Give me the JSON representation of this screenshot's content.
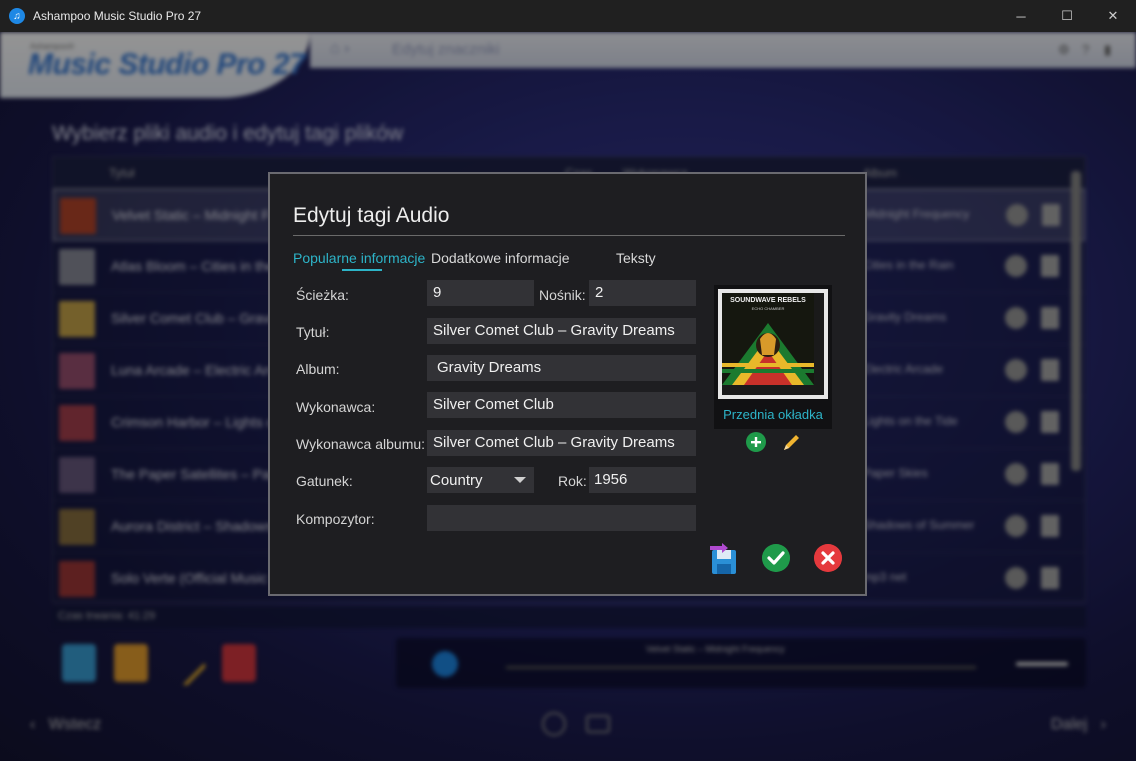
{
  "window": {
    "title": "Ashampoo Music Studio Pro 27",
    "minimize": "─",
    "maximize": "☐",
    "close": "✕"
  },
  "background": {
    "logo_small": "Ashampoo®",
    "logo": "Music Studio Pro 27",
    "breadcrumb": "Edytuj znaczniki",
    "heading": "Wybierz pliki audio i edytuj tagi plików",
    "columns": [
      "Tytuł",
      "Czas",
      "Wykonawca",
      "Album"
    ],
    "rows": [
      {
        "title": "Velvet Static – Midnight Frequency",
        "album": "Midnight Frequency",
        "color": "#b5452a"
      },
      {
        "title": "Atlas Bloom – Cities in the Rain",
        "album": "Cities in the Rain",
        "color": "#8a8c9a"
      },
      {
        "title": "Silver Comet Club – Gravity Dreams",
        "album": "Gravity Dreams",
        "color": "#c9a64a"
      },
      {
        "title": "Luna Arcade – Electric Arcade",
        "album": "Electric Arcade",
        "color": "#9a5070"
      },
      {
        "title": "Crimson Harbor – Lights on the Tide",
        "album": "Lights on the Tide",
        "color": "#a8404e"
      },
      {
        "title": "The Paper Satellites – Paper Skies",
        "album": "Paper Skies",
        "color": "#6a5a80"
      },
      {
        "title": "Aurora District – Shadows of Summer",
        "album": "Shadows of Summer",
        "color": "#8a7040"
      },
      {
        "title": "Solo Verte (Official Music Video)",
        "album": "mp3 net",
        "color": "#a03838"
      }
    ],
    "status": "Czas trwania: 41:29",
    "player_title": "Velvet Static – Midnight Frequency",
    "back": "Wstecz",
    "next": "Dalej"
  },
  "dialog": {
    "title": "Edytuj tagi Audio",
    "tabs": [
      "Popularne informacje",
      "Dodatkowe informacje",
      "Teksty"
    ],
    "labels": {
      "track": "Ścieżka:",
      "disc": "Nośnik:",
      "title": "Tytuł:",
      "album": "Album:",
      "artist": "Wykonawca:",
      "album_artist": "Wykonawca albumu:",
      "genre": "Gatunek:",
      "year": "Rok:",
      "composer": "Kompozytor:"
    },
    "values": {
      "track": "9",
      "disc": "2",
      "title": "Silver Comet Club – Gravity Dreams",
      "album": "Gravity Dreams",
      "artist": "Silver Comet Club",
      "album_artist": "Silver Comet Club – Gravity Dreams",
      "genre": "Country",
      "year": "1956",
      "composer": ""
    },
    "cover": {
      "caption": "Przednia okładka",
      "art_title": "SOUNDWAVE REBELS",
      "art_subtitle": "ECHO CHAMBER"
    }
  }
}
